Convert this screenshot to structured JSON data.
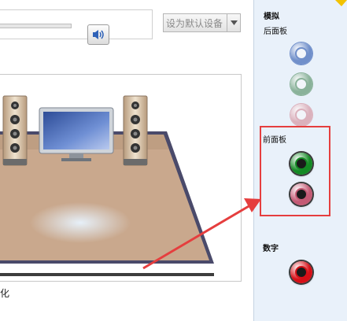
{
  "toolbar": {
    "default_device_label": "设为默认设备"
  },
  "stage": {
    "config_label": "化"
  },
  "panel": {
    "analog_heading": "模拟",
    "back_panel_label": "后面板",
    "front_panel_label": "前面板",
    "digital_heading": "数字",
    "back_jacks": [
      {
        "name": "back-jack-blue",
        "color": "#5b7ec2"
      },
      {
        "name": "back-jack-green",
        "color": "#7aa88a"
      },
      {
        "name": "back-jack-pink",
        "color": "#d9a6b2"
      }
    ],
    "front_jacks": [
      {
        "name": "front-jack-green",
        "color": "#148a24"
      },
      {
        "name": "front-jack-pink",
        "color": "#c45a74"
      }
    ],
    "digital_jack": {
      "color": "#d60f17"
    }
  },
  "colors": {
    "accent_red": "#e53e3e",
    "panel_bg": "#e9f1fa",
    "floor": "#c9a88d"
  }
}
